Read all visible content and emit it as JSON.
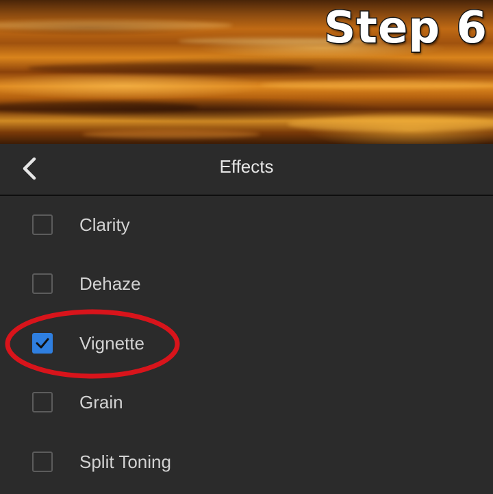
{
  "overlay": {
    "step_title": "Step 6"
  },
  "header": {
    "title": "Effects",
    "back_icon": "chevron-left-icon"
  },
  "effects": {
    "items": [
      {
        "label": "Clarity",
        "checked": false
      },
      {
        "label": "Dehaze",
        "checked": false
      },
      {
        "label": "Vignette",
        "checked": true
      },
      {
        "label": "Grain",
        "checked": false
      },
      {
        "label": "Split Toning",
        "checked": false
      }
    ]
  },
  "colors": {
    "background": "#2b2b2b",
    "accent_checkbox": "#2f7fe0",
    "annotation_ring": "#d8141b",
    "text": "#d2d2d2"
  }
}
